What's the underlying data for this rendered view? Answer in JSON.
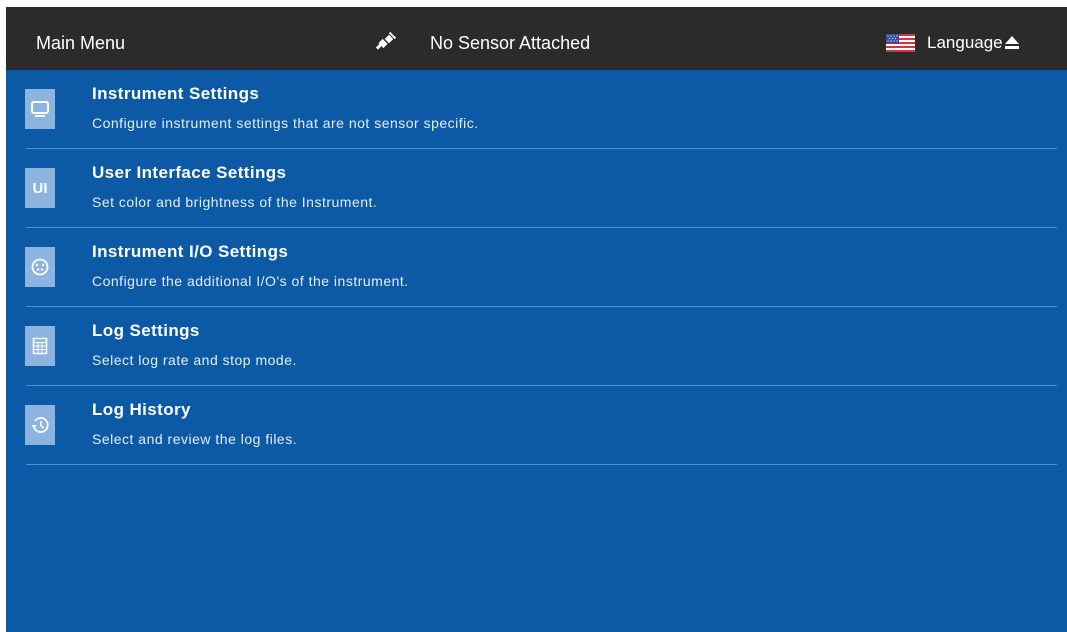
{
  "header": {
    "title": "Main Menu",
    "sensor_status": "No Sensor Attached",
    "language_label": "Language",
    "icons": {
      "sensor": "unplugged-connector-icon",
      "flag": "us-flag-icon",
      "eject": "eject-icon"
    }
  },
  "menu": {
    "items": [
      {
        "title": "Instrument Settings",
        "description": "Configure instrument settings that are not sensor specific.",
        "icon": "monitor-icon"
      },
      {
        "title": "User Interface Settings",
        "description": "Set color and brightness of the Instrument.",
        "icon": "ui-icon",
        "icon_text": "UI"
      },
      {
        "title": "Instrument I/O Settings",
        "description": "Configure the additional I/O's of the instrument.",
        "icon": "connector-port-icon"
      },
      {
        "title": "Log Settings",
        "description": "Select log rate and stop mode.",
        "icon": "log-table-icon"
      },
      {
        "title": "Log History",
        "description": "Select and review the log files.",
        "icon": "history-icon"
      }
    ]
  },
  "colors": {
    "background": "#0c5aa6",
    "topbar": "#2b2b2b",
    "icon_tile": "#8cb4de",
    "divider": "#5b8fc7"
  }
}
